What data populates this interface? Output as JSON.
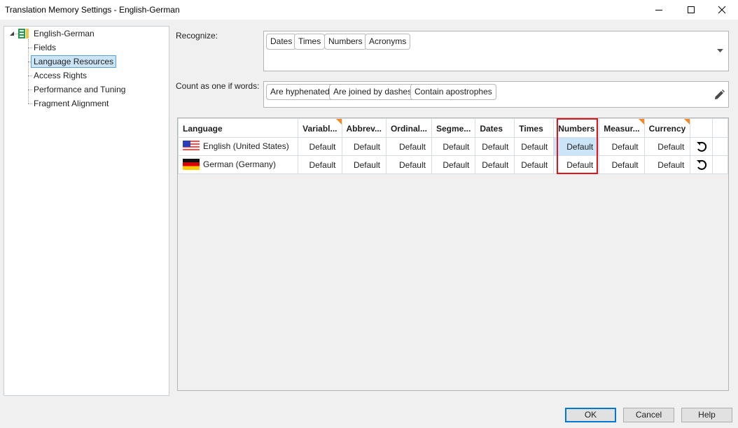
{
  "window": {
    "title": "Translation Memory Settings - English-German",
    "controls": [
      "minimize-icon",
      "maximize-icon",
      "close-icon"
    ]
  },
  "tree": {
    "root": {
      "label": "English-German",
      "icon": "translation-memory-icon",
      "expanded": true
    },
    "items": [
      {
        "label": "Fields",
        "selected": false
      },
      {
        "label": "Language Resources",
        "selected": true
      },
      {
        "label": "Access Rights",
        "selected": false
      },
      {
        "label": "Performance and Tuning",
        "selected": false
      },
      {
        "label": "Fragment Alignment",
        "selected": false
      }
    ]
  },
  "recognize": {
    "label": "Recognize:",
    "tokens": [
      "Dates",
      "Times",
      "Numbers",
      "Acronyms"
    ],
    "dropdown_icon": "caret-down-icon"
  },
  "count_as_one": {
    "label": "Count as one if words:",
    "tokens": [
      "Are hyphenated",
      "Are joined by dashes",
      "Contain apostrophes"
    ],
    "edit_icon": "pencil-icon"
  },
  "grid": {
    "columns": [
      {
        "label": "Language",
        "modified": false
      },
      {
        "label": "Variabl...",
        "modified": true
      },
      {
        "label": "Abbrev...",
        "modified": false
      },
      {
        "label": "Ordinal...",
        "modified": false
      },
      {
        "label": "Segme...",
        "modified": false
      },
      {
        "label": "Dates",
        "modified": false
      },
      {
        "label": "Times",
        "modified": false
      },
      {
        "label": "Numbers",
        "modified": false,
        "highlighted": true
      },
      {
        "label": "Measur...",
        "modified": true
      },
      {
        "label": "Currency",
        "modified": true
      },
      {
        "label": "",
        "modified": false
      },
      {
        "label": "",
        "modified": false
      }
    ],
    "rows": [
      {
        "language": "English (United States)",
        "flag": "us-flag-icon",
        "values": [
          "Default",
          "Default",
          "Default",
          "Default",
          "Default",
          "Default",
          "Default",
          "Default",
          "Default"
        ],
        "reset_icon": "reset-icon"
      },
      {
        "language": "German (Germany)",
        "flag": "de-flag-icon",
        "values": [
          "Default",
          "Default",
          "Default",
          "Default",
          "Default",
          "Default",
          "Default",
          "Default",
          "Default"
        ],
        "reset_icon": "reset-icon"
      }
    ],
    "selected_cell": {
      "row": 0,
      "column": "Numbers"
    }
  },
  "buttons": {
    "ok": "OK",
    "cancel": "Cancel",
    "help": "Help"
  },
  "colors": {
    "selection": "#cce4f7",
    "highlight_border": "#e0141c",
    "modified_marker": "#f08a24",
    "default_button_border": "#0078d7"
  }
}
